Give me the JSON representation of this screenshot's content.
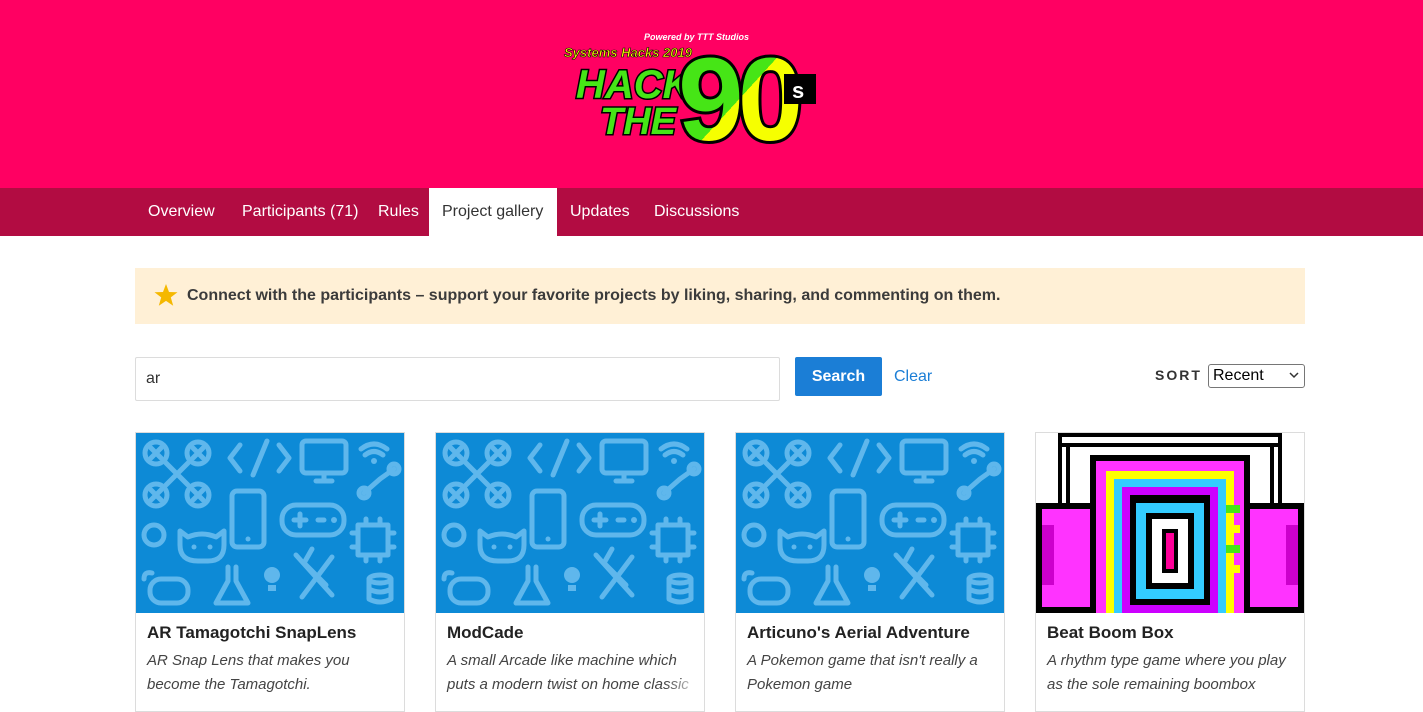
{
  "header": {
    "logo": {
      "powered_by": "Powered by TTT Studios",
      "event": "Systems Hacks 2019",
      "line1": "HACK",
      "line2": "THE",
      "big": "90",
      "suffix": "s"
    },
    "colors": {
      "background": "#ff0062",
      "nav": "#b20c42"
    }
  },
  "nav": {
    "tabs": [
      {
        "label": "Overview"
      },
      {
        "label": "Participants (71)"
      },
      {
        "label": "Rules"
      },
      {
        "label": "Project gallery",
        "active": true
      },
      {
        "label": "Updates"
      },
      {
        "label": "Discussions"
      }
    ]
  },
  "banner": {
    "icon": "star-icon",
    "message": "Connect with the participants – support your favorite projects by liking, sharing, and commenting on them."
  },
  "search": {
    "value": "ar",
    "button_label": "Search",
    "clear_label": "Clear"
  },
  "sort": {
    "label": "SORT",
    "selected": "Recent"
  },
  "projects": [
    {
      "title": "AR Tamagotchi SnapLens",
      "description": "AR Snap Lens that makes you become the Tamagotchi.",
      "thumbnail": "default-pattern"
    },
    {
      "title": "ModCade",
      "description": "A small Arcade like machine which puts a modern twist on home classic",
      "thumbnail": "default-pattern"
    },
    {
      "title": "Articuno's Aerial Adventure",
      "description": "A Pokemon game that isn't really a Pokemon game",
      "thumbnail": "default-pattern"
    },
    {
      "title": "Beat Boom Box",
      "description": "A rhythm type game where you play as the sole remaining boombox",
      "thumbnail": "pixel-boombox"
    }
  ]
}
